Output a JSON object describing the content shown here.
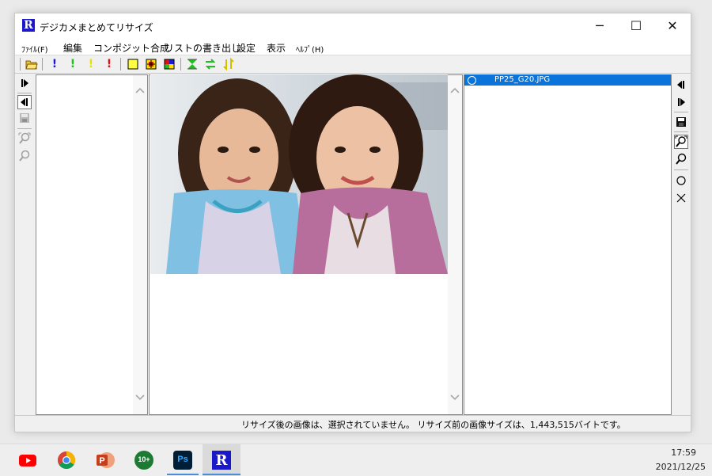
{
  "window": {
    "title": "デジカメまとめてリサイズ",
    "app_icon_letter": "R",
    "minimize_glyph": "─",
    "maximize_glyph": "☐",
    "close_glyph": "✕"
  },
  "menu": {
    "file": "ﾌｧｲﾙ(F)",
    "edit": "編集",
    "composite": "コンポジット合成",
    "export_list": "リストの書き出し",
    "settings": "設定",
    "view": "表示",
    "help": "ﾍﾙﾌﾟ(H)"
  },
  "toolbar": {
    "icons": [
      "open-folder-icon",
      "exclaim-blue-icon",
      "exclaim-green-icon",
      "exclaim-yellow-icon",
      "exclaim-red-icon",
      "frame-yellow-icon",
      "frame-red-icon",
      "frame-grid-icon",
      "resize-icon",
      "swap-horizontal-icon",
      "swap-vertical-icon"
    ]
  },
  "file_list": {
    "items": [
      {
        "name": "PP25_G20.JPG",
        "selected": true
      }
    ]
  },
  "status": {
    "text": "リサイズ後の画像は、選択されていません。 リサイズ前の画像サイズは、1,443,515バイトです。"
  },
  "taskbar": {
    "apps": [
      "youtube-icon",
      "chrome-icon",
      "powerpoint-icon",
      "game-10plus-icon",
      "photoshop-icon",
      "resize-app-icon"
    ],
    "ps_label": "Ps",
    "r_label": "R",
    "game_label": "10+",
    "time": "17:59",
    "date": "2021/12/25"
  },
  "colors": {
    "accent": "#0a74da",
    "app_icon_bg": "#1a18c8"
  }
}
